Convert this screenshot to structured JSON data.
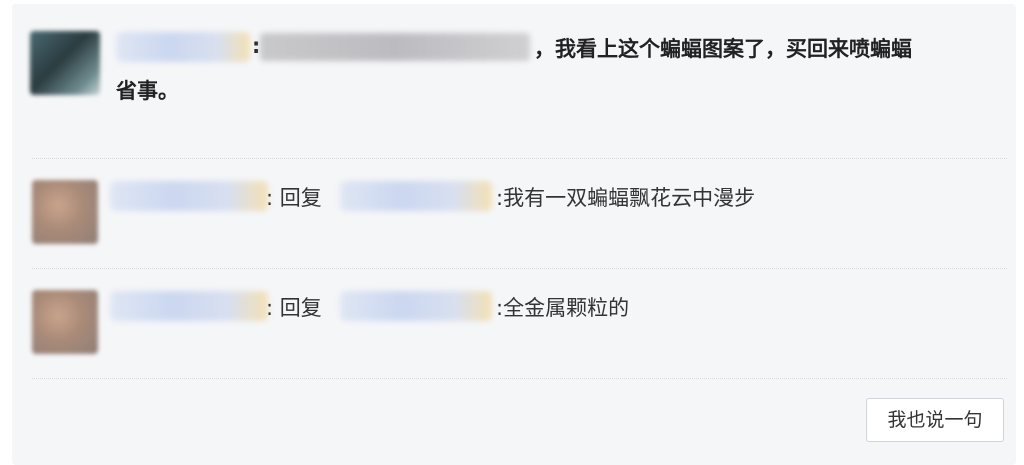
{
  "main_comment": {
    "separator": ":",
    "text_line1": "，我看上这个蝙蝠图案了，买回来喷蝙蝠",
    "text_line2": "省事。"
  },
  "replies": [
    {
      "separator": ": 回复",
      "text": ":我有一双蝙蝠飘花云中漫步"
    },
    {
      "separator": ": 回复",
      "text": ":全金属颗粒的"
    }
  ],
  "reply_button_label": "我也说一句"
}
